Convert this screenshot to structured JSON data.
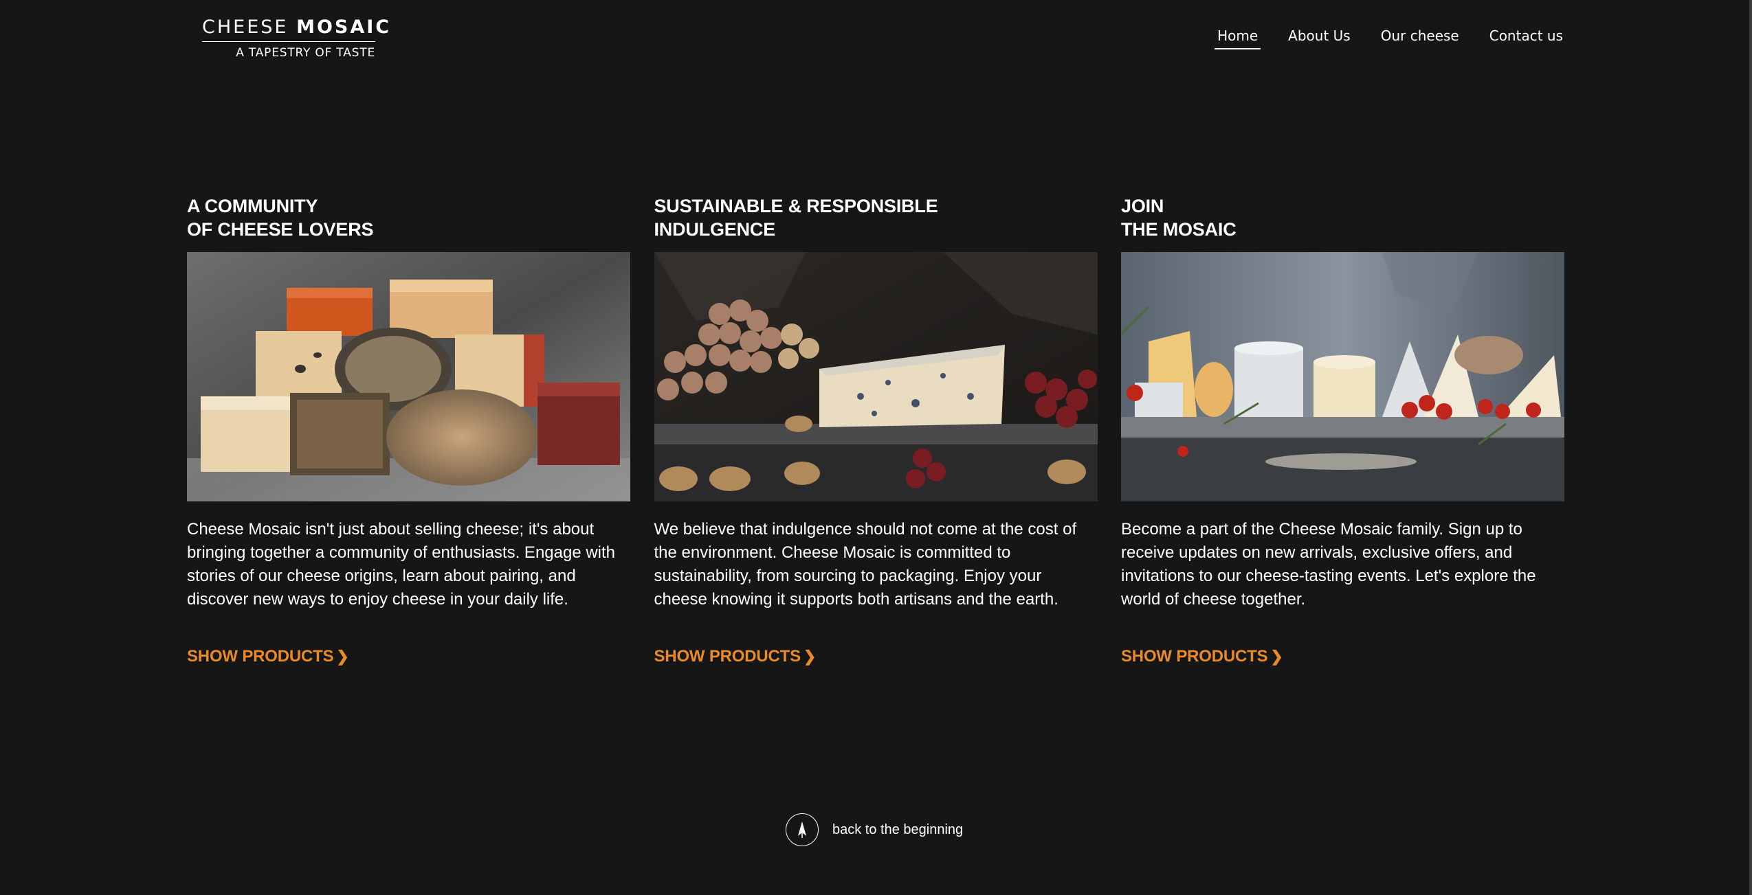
{
  "brand": {
    "name_light": "CHEESE",
    "name_bold": "MOSAIC",
    "tagline": "A TAPESTRY OF TASTE"
  },
  "nav": {
    "items": [
      {
        "label": "Home",
        "active": true
      },
      {
        "label": "About Us",
        "active": false
      },
      {
        "label": "Our cheese",
        "active": false
      },
      {
        "label": "Contact us",
        "active": false
      }
    ]
  },
  "columns": [
    {
      "title_line1": "A COMMUNITY",
      "title_line2": "OF CHEESE LOVERS",
      "text": "Cheese Mosaic isn't just about selling cheese; it's about bringing together a community of enthusiasts. Engage with stories of our cheese origins, learn about pairing, and discover new ways to enjoy cheese in your daily life.",
      "link": "SHOW PRODUCTS",
      "image": "stacked-cheese-wheels-photo"
    },
    {
      "title_line1": "SUSTAINABLE & RESPONSIBLE",
      "title_line2": "INDULGENCE",
      "text": "We believe that indulgence should not come at the cost of the environment. Cheese Mosaic is committed to sustainability, from sourcing to packaging. Enjoy your cheese knowing it supports both artisans and the earth.",
      "link": "SHOW PRODUCTS",
      "image": "blue-cheese-grapes-walnuts-photo"
    },
    {
      "title_line1": "JOIN",
      "title_line2": "THE MOSAIC",
      "text": "Become a part of the Cheese Mosaic family. Sign up to receive updates on new arrivals, exclusive offers, and invitations to our cheese-tasting events. Let's explore the world of cheese together.",
      "link": "SHOW PRODUCTS",
      "image": "cheese-board-tomatoes-photo"
    }
  ],
  "footer": {
    "back_label": "back to the beginning",
    "back_icon": "arrow-up-icon"
  },
  "colors": {
    "background": "#161616",
    "text": "#ffffff",
    "accent": "#e8892a"
  }
}
